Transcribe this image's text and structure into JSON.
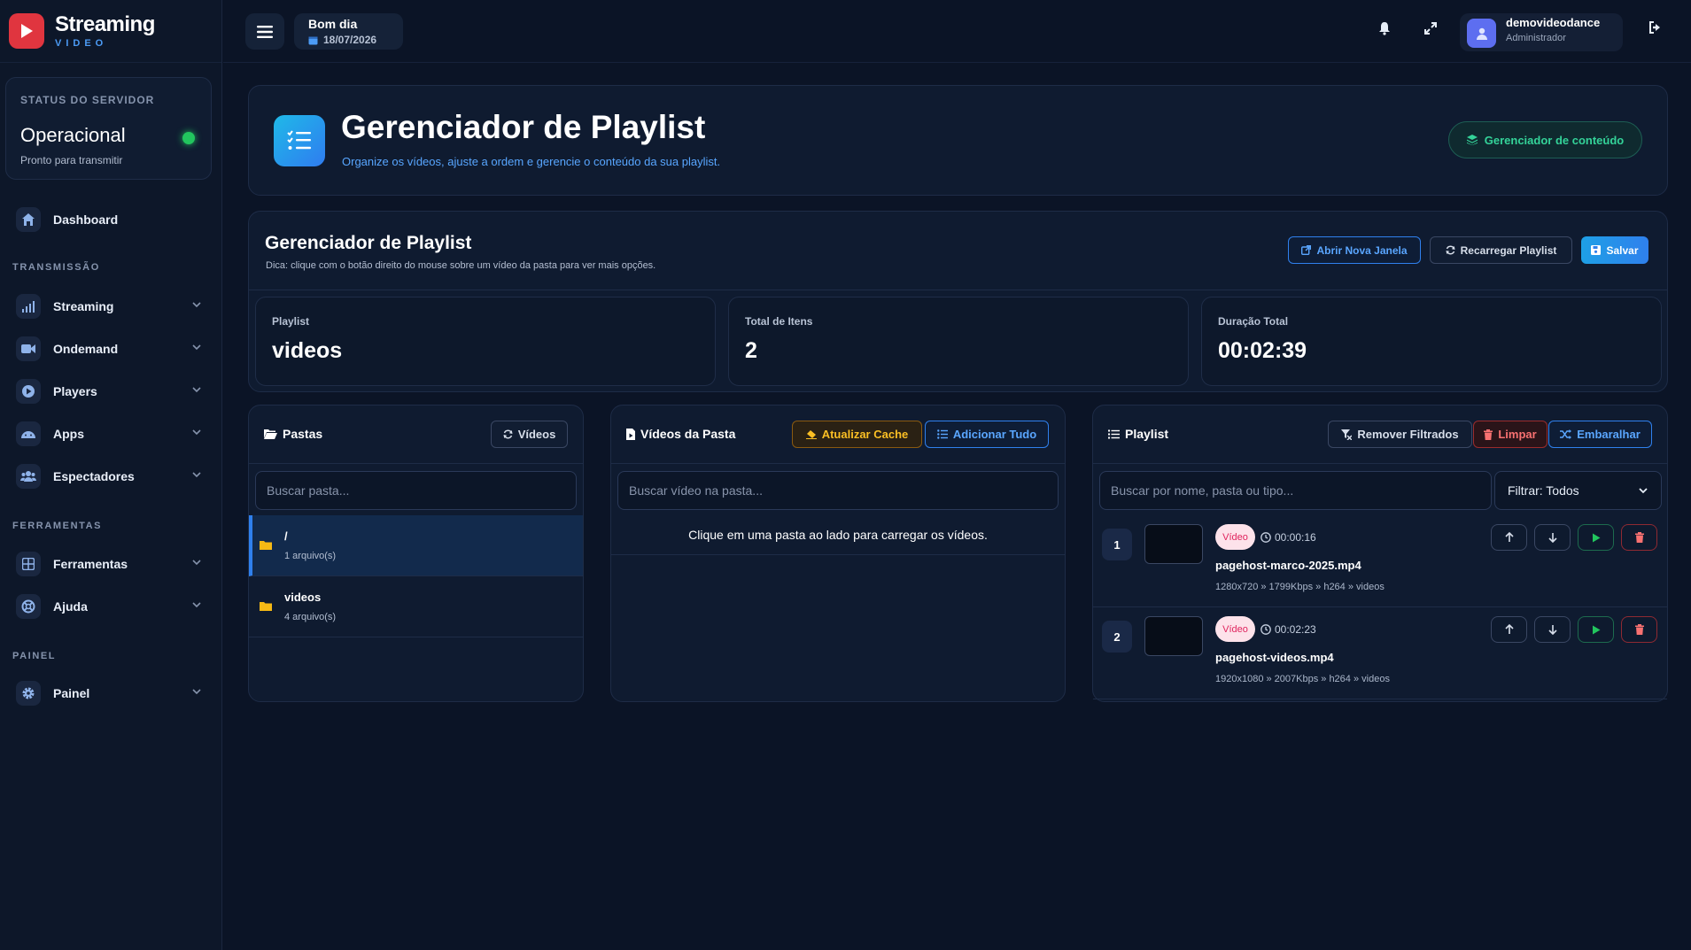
{
  "brand": {
    "title": "Streaming",
    "subtitle": "VIDEO"
  },
  "server": {
    "label": "STATUS DO SERVIDOR",
    "status": "Operacional",
    "sub": "Pronto para transmitir"
  },
  "nav": {
    "dashboard": "Dashboard",
    "section_transmissao": "TRANSMISSÃO",
    "streaming": "Streaming",
    "ondemand": "Ondemand",
    "players": "Players",
    "apps": "Apps",
    "espectadores": "Espectadores",
    "section_ferramentas": "FERRAMENTAS",
    "ferramentas": "Ferramentas",
    "ajuda": "Ajuda",
    "section_painel": "PAINEL",
    "painel": "Painel"
  },
  "topbar": {
    "greeting": "Bom dia",
    "date": "18/07/2026",
    "user_name": "demovideodance",
    "user_role": "Administrador"
  },
  "hero": {
    "title": "Gerenciador de Playlist",
    "subtitle": "Organize os vídeos, ajuste a ordem e gerencie o conteúdo da sua playlist.",
    "button": "Gerenciador de conteúdo"
  },
  "manager": {
    "title": "Gerenciador de Playlist",
    "tip": "Dica: clique com o botão direito do mouse sobre um vídeo da pasta para ver mais opções.",
    "btn_open": "Abrir Nova Janela",
    "btn_reload": "Recarregar Playlist",
    "btn_save": "Salvar",
    "stats": [
      {
        "label": "Playlist",
        "value": "videos"
      },
      {
        "label": "Total de Itens",
        "value": "2"
      },
      {
        "label": "Duração Total",
        "value": "00:02:39"
      }
    ]
  },
  "folders": {
    "title": "Pastas",
    "btn_videos": "Vídeos",
    "search_placeholder": "Buscar pasta...",
    "items": [
      {
        "name": "/",
        "count": "1 arquivo(s)"
      },
      {
        "name": "videos",
        "count": "4 arquivo(s)"
      }
    ]
  },
  "folder_videos": {
    "title": "Vídeos da Pasta",
    "btn_cache": "Atualizar Cache",
    "btn_add_all": "Adicionar Tudo",
    "search_placeholder": "Buscar vídeo na pasta...",
    "empty": "Clique em uma pasta ao lado para carregar os vídeos."
  },
  "playlist": {
    "title": "Playlist",
    "btn_remove": "Remover Filtrados",
    "btn_clear": "Limpar",
    "btn_shuffle": "Embaralhar",
    "search_placeholder": "Buscar por nome, pasta ou tipo...",
    "filter": "Filtrar: Todos",
    "items": [
      {
        "num": "1",
        "badge": "Vídeo",
        "duration": "00:00:16",
        "name": "pagehost-marco-2025.mp4",
        "meta": "1280x720 » 1799Kbps » h264 » videos"
      },
      {
        "num": "2",
        "badge": "Vídeo",
        "duration": "00:02:23",
        "name": "pagehost-videos.mp4",
        "meta": "1920x1080 » 2007Kbps » h264 » videos"
      }
    ]
  },
  "colors": {
    "bg": "#0b1426",
    "accent": "#2f80ed",
    "success": "#22c55e",
    "danger": "#ef4444",
    "warning": "#f59e0b"
  }
}
